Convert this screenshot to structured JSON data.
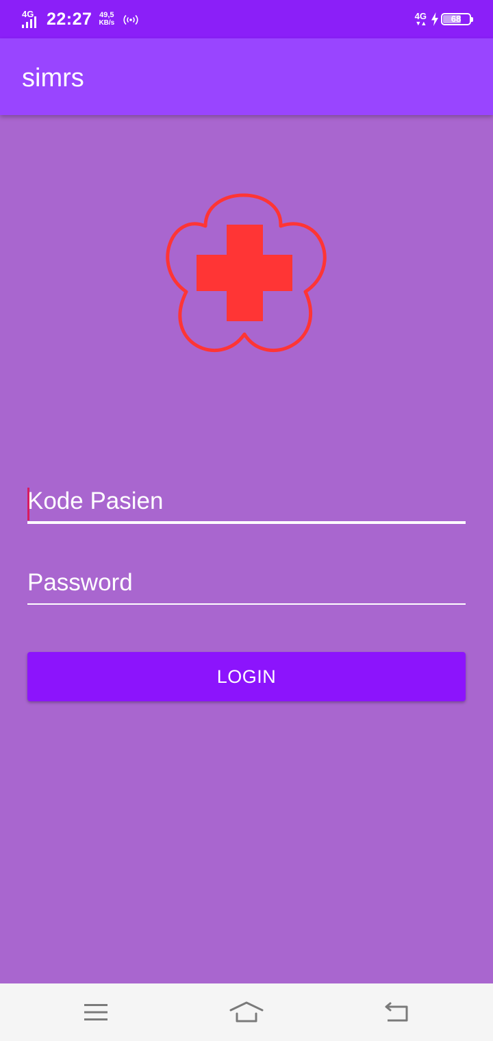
{
  "status_bar": {
    "network_left": "4G",
    "time": "22:27",
    "speed_value": "49,5",
    "speed_unit": "KB/s",
    "hotspot_icon": "hotspot-icon",
    "network_right": "4G",
    "charging_icon": "bolt-icon",
    "battery_level": "68",
    "battery_fraction": 0.68
  },
  "app_bar": {
    "title": "simrs"
  },
  "logo": {
    "icon": "red-cross-flower-logo",
    "color": "#ff3535"
  },
  "form": {
    "kode_pasien": {
      "placeholder": "Kode Pasien",
      "value": ""
    },
    "password": {
      "placeholder": "Password",
      "value": ""
    },
    "login_label": "LOGIN"
  },
  "nav_bar": {
    "menu_icon": "menu-icon",
    "home_icon": "home-icon",
    "back_icon": "back-icon"
  },
  "colors": {
    "status_bar": "#8b1ff8",
    "app_bar": "#9945ff",
    "background": "#a966cf",
    "button": "#8c14fc",
    "accent": "#d81b60",
    "nav_bar": "#f5f5f5"
  }
}
